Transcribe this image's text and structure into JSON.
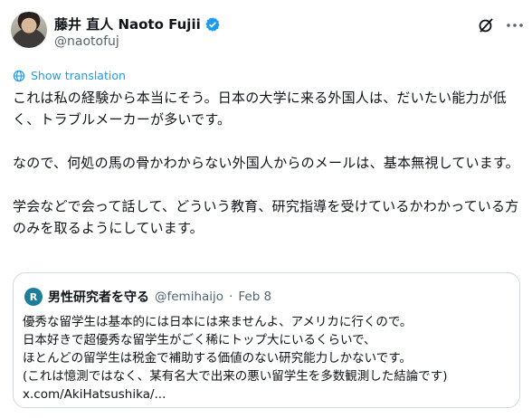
{
  "author": {
    "name": "藤井 直人 Naoto Fujii",
    "handle": "@naotofuj",
    "avatar_alt": "profile photo",
    "verified_icon": "verified-badge-icon"
  },
  "header_icons": [
    "grok-icon",
    "more-icon"
  ],
  "translate": {
    "label": "Show translation",
    "icon": "globe-icon"
  },
  "tweet": {
    "text": "これは私の経験から本当にそう。日本の大学に来る外国人は、だいたい能力が低く、トラブルメーカーが多いです。\n\nなので、何処の馬の骨かわからない外国人からのメールは、基本無視しています。\n\n学会などで会って話して、どういう教育、研究指導を受けているかわかっている方のみを取るようにしています。"
  },
  "quote": {
    "avatar_letter": "R",
    "name": "男性研究者を守る",
    "handle": "@femihaijo",
    "separator": "·",
    "date": "Feb 8",
    "text": "優秀な留学生は基本的には日本には来ませんよ、アメリカに行くので。\n日本好きで超優秀な留学生がごく稀にトップ大にいるくらいで、\nほとんどの留学生は税金で補助する価値のない研究能力しかないです。\n(これは憶測ではなく、某有名大で出来の悪い留学生を多数観測した結論です)\nx.com/AkiHatsushika/..."
  },
  "colors": {
    "accent": "#1d9bf0",
    "text": "#0f1419",
    "muted": "#536471",
    "border": "#cfd9de"
  }
}
